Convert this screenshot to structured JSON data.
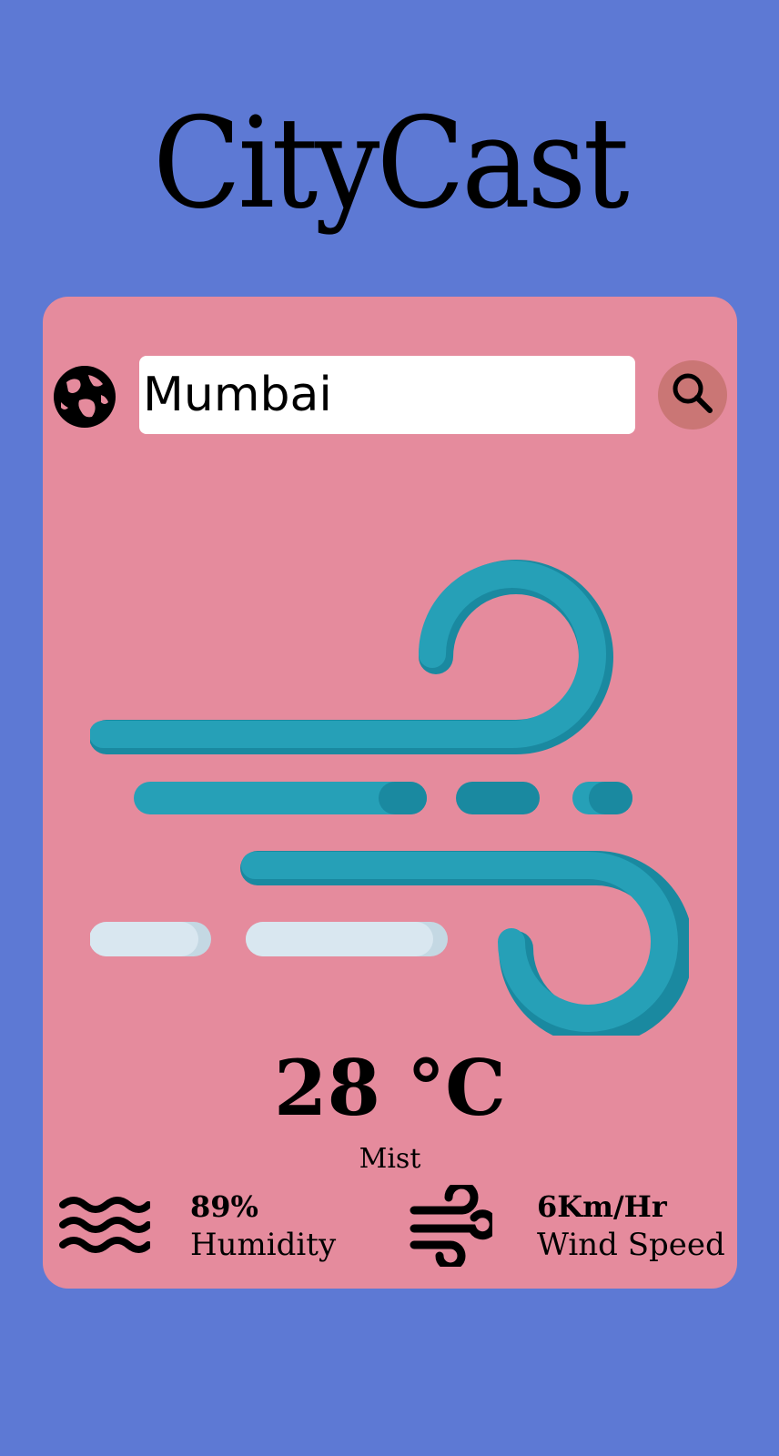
{
  "app": {
    "title": "CityCast"
  },
  "search": {
    "value": "Mumbai",
    "placeholder": ""
  },
  "weather": {
    "temperature": "28 °C",
    "condition": "Mist",
    "icon": "wind-weather-illustration"
  },
  "stats": {
    "humidity": {
      "value": "89%",
      "label": "Humidity",
      "icon": "humidity-waves-icon"
    },
    "wind": {
      "value": "6Km/Hr",
      "label": "Wind Speed",
      "icon": "wind-icon"
    }
  },
  "colors": {
    "background": "#5d79d4",
    "card": "#e58b9d",
    "search_button": "#ca7675",
    "wind_teal": "#26a0b7",
    "wind_teal_dark": "#1a89a0",
    "cloud_light": "#d9e7f0"
  }
}
